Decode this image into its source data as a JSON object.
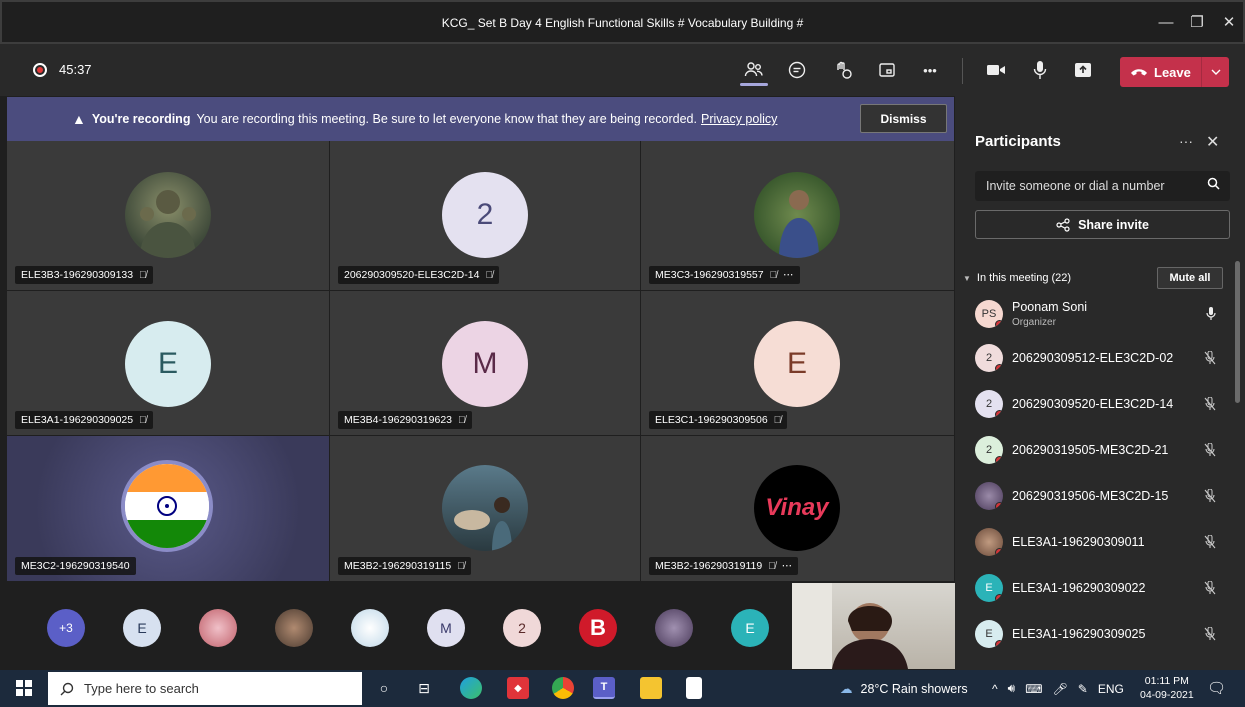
{
  "window": {
    "title": "KCG_ Set B Day 4 English Functional Skills # Vocabulary Building #",
    "minimize": "—",
    "maximize": "❐",
    "close": "✕"
  },
  "meeting": {
    "timer": "45:37",
    "more": "•••",
    "leave_label": "Leave"
  },
  "banner": {
    "bold": "You're recording",
    "message": "You are recording this meeting. Be sure to let everyone know that they are being recorded.",
    "link": "Privacy policy",
    "dismiss": "Dismiss"
  },
  "tiles": [
    {
      "name": "ELE3B3-196290309133",
      "initial": "",
      "muted": true,
      "more": false
    },
    {
      "name": "206290309520-ELE3C2D-14",
      "initial": "2",
      "muted": true,
      "more": false
    },
    {
      "name": "ME3C3-196290319557",
      "initial": "",
      "muted": true,
      "more": true
    },
    {
      "name": "ELE3A1-196290309025",
      "initial": "E",
      "muted": true,
      "more": false
    },
    {
      "name": "ME3B4-196290319623",
      "initial": "M",
      "muted": true,
      "more": false
    },
    {
      "name": "ELE3C1-196290309506",
      "initial": "E",
      "muted": true,
      "more": false
    },
    {
      "name": "ME3C2-196290319540",
      "initial": "",
      "muted": false,
      "more": false
    },
    {
      "name": "ME3B2-196290319115",
      "initial": "",
      "muted": true,
      "more": false
    },
    {
      "name": "ME3B2-196290319119",
      "initial": "",
      "muted": true,
      "more": true,
      "logo": "Vinay"
    }
  ],
  "strip": {
    "overflow": "+3",
    "items": [
      "E",
      "",
      "",
      "",
      "M",
      "2",
      "B",
      "",
      "E"
    ]
  },
  "panel": {
    "title": "Participants",
    "more": "···",
    "invite_placeholder": "Invite someone or dial a number",
    "share_invite": "Share invite",
    "in_meeting": "In this meeting (22)",
    "mute_all": "Mute all",
    "participants": [
      {
        "initials": "PS",
        "name": "Poonam Soni",
        "role": "Organizer",
        "mic": "on"
      },
      {
        "initials": "2",
        "name": "206290309512-ELE3C2D-02",
        "role": "",
        "mic": "off"
      },
      {
        "initials": "2",
        "name": "206290309520-ELE3C2D-14",
        "role": "",
        "mic": "off"
      },
      {
        "initials": "2",
        "name": "206290319505-ME3C2D-21",
        "role": "",
        "mic": "off"
      },
      {
        "initials": "",
        "name": "206290319506-ME3C2D-15",
        "role": "",
        "mic": "off"
      },
      {
        "initials": "",
        "name": "ELE3A1-196290309011",
        "role": "",
        "mic": "off"
      },
      {
        "initials": "E",
        "name": "ELE3A1-196290309022",
        "role": "",
        "mic": "off"
      },
      {
        "initials": "E",
        "name": "ELE3A1-196290309025",
        "role": "",
        "mic": "off"
      }
    ]
  },
  "taskbar": {
    "search_placeholder": "Type here to search",
    "weather": "28°C  Rain showers",
    "lang": "ENG",
    "time": "01:11 PM",
    "date": "04-09-2021"
  },
  "colors": {
    "accent": "#4b4c7e",
    "leave": "#c4314b",
    "recording": "#e03a3a",
    "people_underline": "#a6a7dc"
  }
}
